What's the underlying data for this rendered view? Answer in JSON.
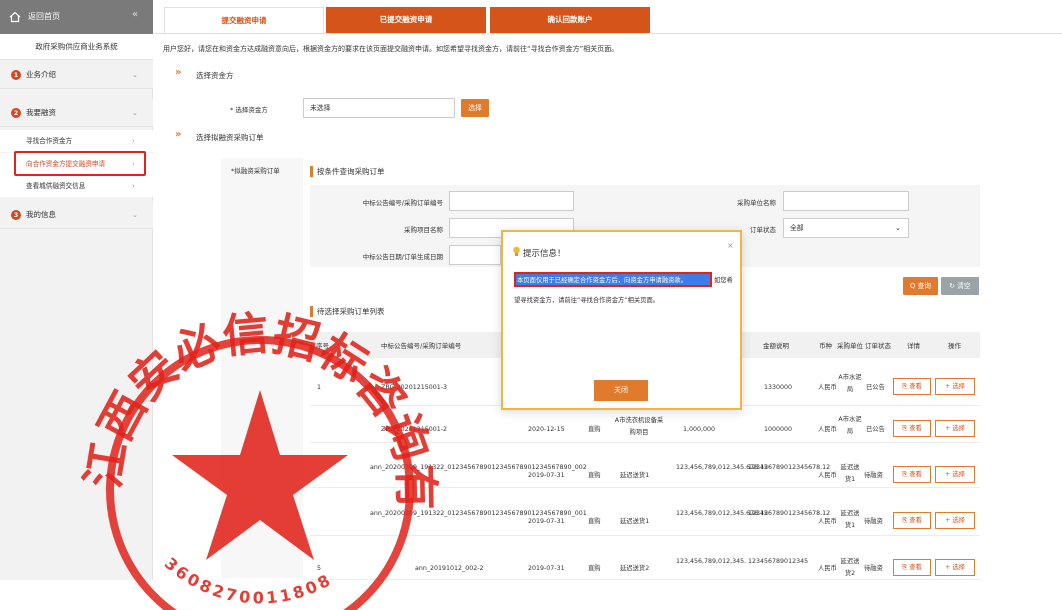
{
  "sidebar": {
    "back_label": "返回首页",
    "collapse_icon": "«",
    "system_name": "政府采购供应商业务系统",
    "items": [
      {
        "num": "1",
        "label": "业务介绍"
      },
      {
        "num": "2",
        "label": "我要融资"
      },
      {
        "num": "3",
        "label": "我的信息"
      }
    ],
    "subitems": [
      {
        "label": "寻找合作资金方"
      },
      {
        "label": "向合作资金方提交融资申请"
      },
      {
        "label": "查看城供融资交信息"
      }
    ]
  },
  "tabs": [
    {
      "label": "提交融资申请"
    },
    {
      "label": "已提交融资申请"
    },
    {
      "label": "确认回款账户"
    }
  ],
  "intro_text": "用户您好，请您在和资金方达成融资意向后，根据资金方的要求在该页面提交融资申请。如您希望寻找资金方，请前往“寻找合作资金方”相关页面。",
  "section1": {
    "title": "选择资金方",
    "field_label": "* 选择资金方",
    "field_value": "未选择",
    "select_button": "选择"
  },
  "section2": {
    "title": "选择拟融资采购订单",
    "side_label": "*拟融资采购订单",
    "sub_title": "按条件查询采购订单",
    "form": {
      "notice_no_label": "中标公告编号/采购订单编号",
      "purchaser_label": "采购单位名称",
      "project_label": "采购项目名称",
      "status_label": "订单状态",
      "status_value": "全部",
      "date_label": "中标公告日期/订单生成日期"
    },
    "query_button": "查询",
    "reset_button": "清空",
    "list_title": "待选择采购订单列表"
  },
  "table": {
    "headers": [
      "序号",
      "中标公告编号/采购订单编号",
      "金额说明",
      "币种",
      "采购单位",
      "订单状态",
      "详情",
      "操作"
    ],
    "rows": [
      {
        "idx": "1",
        "no": "ZBG-20201215001-3",
        "date": "",
        "type": "",
        "proj": "",
        "amount": "",
        "amount_note": "1330000",
        "cur": "人民币",
        "unit": "A市水泥局",
        "status": "已公告",
        "view": "查看",
        "pick": "+ 选择"
      },
      {
        "idx": "",
        "no": "ZBG-20201215001-2",
        "date": "2020-12-15",
        "type": "直购",
        "proj": "A市洗衣机设备采购项目",
        "amount": "1,000,000",
        "amount_note": "1000000",
        "cur": "人民币",
        "unit": "A市水泥局",
        "status": "已公告",
        "view": "查看",
        "pick": "+ 选择"
      },
      {
        "idx": "",
        "no": "ann_20200309_191322_0123456789012345678901234567890_002",
        "date": "2019-07-31",
        "type": "直购",
        "proj": "延迟送货1",
        "amount": "123,456,789,012,345.678.12",
        "amount_note": "123456789012345678.12",
        "cur": "人民币",
        "unit": "延迟送货1",
        "status": "待融资",
        "view": "查看",
        "pick": "+ 选择"
      },
      {
        "idx": "",
        "no": "ann_20200309_191322_0123456789012345678901234567890_001",
        "date": "2019-07-31",
        "type": "直购",
        "proj": "延迟送货1",
        "amount": "123,456,789,012,345.678.12",
        "amount_note": "123456789012345678.12",
        "cur": "人民币",
        "unit": "延迟送货1",
        "status": "待融资",
        "view": "查看",
        "pick": "+ 选择"
      },
      {
        "idx": "5",
        "no": "ann_20191012_002-2",
        "date": "2019-07-31",
        "type": "直购",
        "proj": "延迟送货2",
        "amount": "123,456,789,012,345.",
        "amount_note": "123456789012345",
        "cur": "人民币",
        "unit": "延迟送货2",
        "status": "待融资",
        "view": "查看",
        "pick": "+ 选择"
      }
    ]
  },
  "modal": {
    "title": "提示信息！",
    "highlight_text": "本页面仅用于已经确定合作资金方后，向资金方申请融资款。",
    "tail_text": "如您希",
    "line2": "望寻找资金方，请前往“寻找合作资金方”相关页面。",
    "close_label": "×",
    "ok_label": "关闭"
  },
  "seal": {
    "text": "江西安必信招标咨询有限公司",
    "number": "3608270011808"
  },
  "colors": {
    "accent": "#d4541a",
    "highlight": "#e0231b",
    "modal_border": "#f0b640"
  }
}
